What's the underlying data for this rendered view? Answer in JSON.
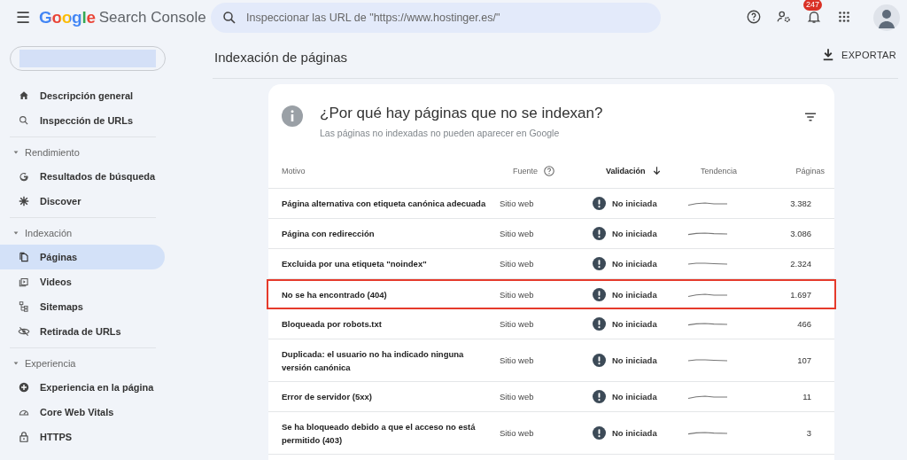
{
  "header": {
    "menu_icon": "☰",
    "brand": "Google",
    "product": "Search Console",
    "search": {
      "placeholder": "Inspeccionar las URL de \"https://www.hostinger.es/\""
    },
    "notifications": "247"
  },
  "sidebar": {
    "items": [
      {
        "kind": "item",
        "label": "Descripción general",
        "selected": false
      },
      {
        "kind": "item",
        "label": "Inspección de URLs",
        "selected": false
      },
      {
        "kind": "divider"
      },
      {
        "kind": "section",
        "label": "Rendimiento"
      },
      {
        "kind": "item",
        "label": "Resultados de búsqueda",
        "selected": false
      },
      {
        "kind": "item",
        "label": "Discover",
        "selected": false
      },
      {
        "kind": "divider"
      },
      {
        "kind": "section",
        "label": "Indexación"
      },
      {
        "kind": "item",
        "label": "Páginas",
        "selected": true
      },
      {
        "kind": "item",
        "label": "Videos",
        "selected": false
      },
      {
        "kind": "item",
        "label": "Sitemaps",
        "selected": false
      },
      {
        "kind": "item",
        "label": "Retirada de URLs",
        "selected": false
      },
      {
        "kind": "divider"
      },
      {
        "kind": "section",
        "label": "Experiencia"
      },
      {
        "kind": "item",
        "label": "Experiencia en la página",
        "selected": false
      },
      {
        "kind": "item",
        "label": "Core Web Vitals",
        "selected": false
      },
      {
        "kind": "item",
        "label": "HTTPS",
        "selected": false
      }
    ]
  },
  "page": {
    "title": "Indexación de páginas",
    "export": "EXPORTAR"
  },
  "card": {
    "title": "¿Por qué hay páginas que no se indexan?",
    "subtitle": "Las páginas no indexadas no pueden aparecer en Google",
    "columns": [
      {
        "label": "Motivo"
      },
      {
        "label": "Fuente",
        "help": true
      },
      {
        "label": "Validación",
        "sorted": true
      },
      {
        "label": "Tendencia"
      },
      {
        "label": "Páginas"
      }
    ],
    "rows": [
      {
        "reason": "Página alternativa con etiqueta canónica adecuada",
        "source": "Sitio web",
        "validation": "No iniciada",
        "pages": "3.382",
        "highlighted": false
      },
      {
        "reason": "Página con redirección",
        "source": "Sitio web",
        "validation": "No iniciada",
        "pages": "3.086",
        "highlighted": false
      },
      {
        "reason": "Excluida por una etiqueta \"noindex\"",
        "source": "Sitio web",
        "validation": "No iniciada",
        "pages": "2.324",
        "highlighted": false
      },
      {
        "reason": "No se ha encontrado (404)",
        "source": "Sitio web",
        "validation": "No iniciada",
        "pages": "1.697",
        "highlighted": true
      },
      {
        "reason": "Bloqueada por robots.txt",
        "source": "Sitio web",
        "validation": "No iniciada",
        "pages": "466",
        "highlighted": false
      },
      {
        "reason": "Duplicada: el usuario no ha indicado ninguna versión canónica",
        "source": "Sitio web",
        "validation": "No iniciada",
        "pages": "107",
        "highlighted": false
      },
      {
        "reason": "Error de servidor (5xx)",
        "source": "Sitio web",
        "validation": "No iniciada",
        "pages": "11",
        "highlighted": false
      },
      {
        "reason": "Se ha bloqueado debido a que el acceso no está permitido (403)",
        "source": "Sitio web",
        "validation": "No iniciada",
        "pages": "3",
        "highlighted": false
      }
    ]
  }
}
